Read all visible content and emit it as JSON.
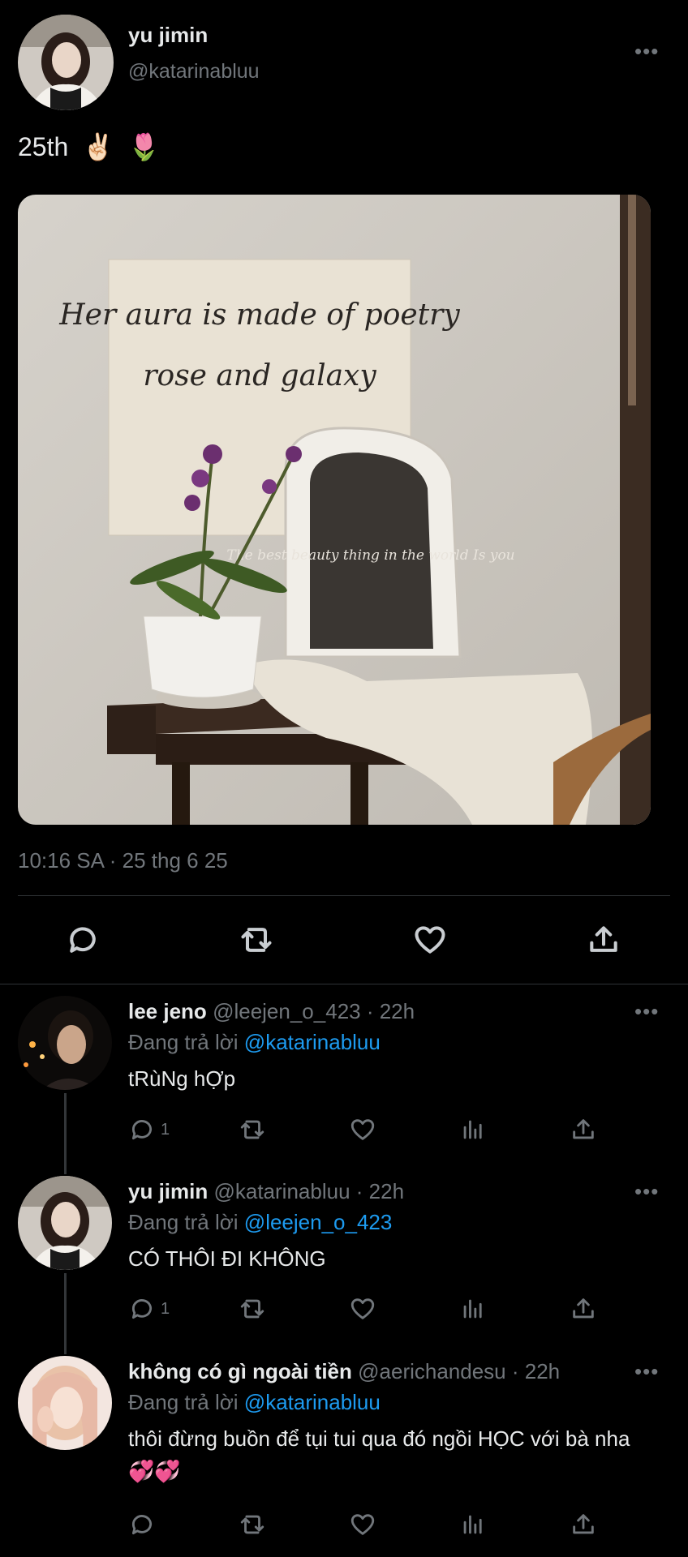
{
  "main_tweet": {
    "name": "yu jimin",
    "handle": "@katarinabluu",
    "text": "25th",
    "emojis": [
      "✌🏻",
      "🌷"
    ],
    "photo_text": {
      "banner_line1": "Her aura is made of poetry",
      "banner_line2": "rose and galaxy",
      "mirror_text": "The best beauty thing in the world Is you"
    },
    "meta": "10:16 SA · 25 thg 6 25",
    "actions": [
      "reply-icon",
      "retweet-icon",
      "like-icon",
      "share-icon"
    ]
  },
  "replies": [
    {
      "name": "lee jeno",
      "handle": "@leejen_o_423",
      "time": "· 22h",
      "replying_prefix": "Đang trả lời",
      "replying_to": "@katarinabluu",
      "text": "tRùNg hỢp",
      "reply_count": "1"
    },
    {
      "name": "yu jimin",
      "handle": "@katarinabluu",
      "time": "· 22h",
      "replying_prefix": "Đang trả lời",
      "replying_to": "@leejen_o_423",
      "text": "CÓ THÔI ĐI KHÔNG",
      "reply_count": "1"
    },
    {
      "name": "không có gì ngoài tiền",
      "handle": "@aerichandesu",
      "time": "· 22h",
      "replying_prefix": "Đang trả lời",
      "replying_to": "@katarinabluu",
      "text": "thôi đừng buồn để tụi tui qua đó ngồi HỌC với bà nha",
      "emojis": "💞💞",
      "reply_count": ""
    }
  ],
  "more_label": "•••",
  "colors": {
    "background": "#000000",
    "text": "#e7e9ea",
    "muted": "#71767b",
    "link": "#1d9bf0",
    "divider": "#2f3336"
  }
}
